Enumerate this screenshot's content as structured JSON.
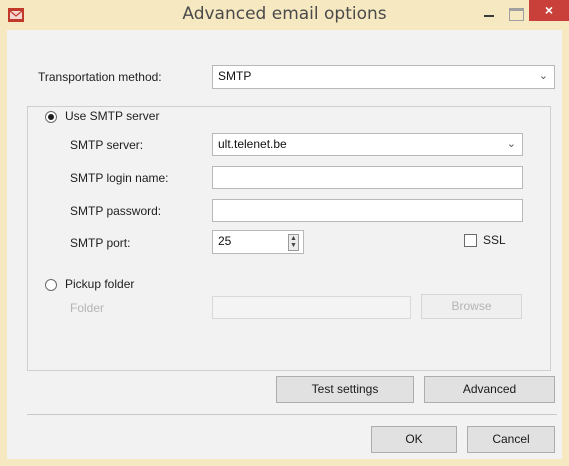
{
  "window": {
    "title": "Advanced email options",
    "close_glyph": "×",
    "icon": "envelope-icon",
    "colors": {
      "frame": "#f6e9c2",
      "close": "#c9403a"
    }
  },
  "transport": {
    "label": "Transportation method:",
    "value": "SMTP"
  },
  "smtp": {
    "radio_label": "Use SMTP server",
    "selected": true,
    "server_label": "SMTP server:",
    "server_value": "ult.telenet.be",
    "login_label": "SMTP login name:",
    "login_value": "",
    "password_label": "SMTP password:",
    "password_value": "",
    "port_label": "SMTP port:",
    "port_value": "25",
    "ssl_label": "SSL",
    "ssl_checked": false
  },
  "pickup": {
    "radio_label": "Pickup folder",
    "selected": false,
    "folder_label": "Folder",
    "folder_value": "",
    "browse_label": "Browse"
  },
  "buttons": {
    "test_settings": "Test settings",
    "advanced": "Advanced",
    "ok": "OK",
    "cancel": "Cancel"
  }
}
